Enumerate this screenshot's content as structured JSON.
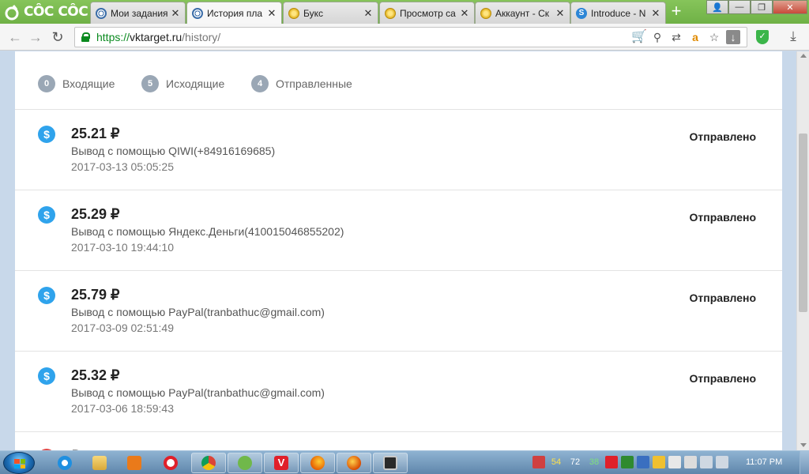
{
  "browser": {
    "brand": "CÔC CÔC",
    "tabs": [
      {
        "title": "Мои задания",
        "icon": "vktarget-icon"
      },
      {
        "title": "История пла",
        "icon": "vktarget-icon",
        "active": true
      },
      {
        "title": "Букс",
        "icon": "coin-icon"
      },
      {
        "title": "Просмотр са",
        "icon": "coin-icon"
      },
      {
        "title": "Аккаунт - Ск",
        "icon": "coin-icon"
      },
      {
        "title": "Introduce - N",
        "icon": "s-icon"
      }
    ],
    "close_glyph": "✕",
    "new_tab_glyph": "+",
    "url": {
      "scheme": "https://",
      "host": "vktarget.ru",
      "path": "/history/"
    }
  },
  "filters": [
    {
      "count": "0",
      "label": "Входящие"
    },
    {
      "count": "5",
      "label": "Исходящие"
    },
    {
      "count": "4",
      "label": "Отправленные"
    }
  ],
  "transactions": [
    {
      "amount": "25.21 ₽",
      "method": "Вывод с помощью QIWI(+84916169685)",
      "date": "2017-03-13 05:05:25",
      "status": "Отправлено"
    },
    {
      "amount": "25.29 ₽",
      "method": "Вывод с помощью Яндекс.Деньги(410015046855202)",
      "date": "2017-03-10 19:44:10",
      "status": "Отправлено"
    },
    {
      "amount": "25.79 ₽",
      "method": "Вывод с помощью PayPal(tranbathuc@gmail.com)",
      "date": "2017-03-09 02:51:49",
      "status": "Отправлено"
    },
    {
      "amount": "25.32 ₽",
      "method": "Вывод с помощью PayPal(tranbathuc@gmail.com)",
      "date": "2017-03-06 18:59:43",
      "status": "Отправлено"
    }
  ],
  "partial_row": {
    "amount": "₽"
  },
  "taskbar": {
    "tray_numbers": [
      "54",
      "72",
      "38"
    ],
    "clock": "11:07 PM"
  }
}
